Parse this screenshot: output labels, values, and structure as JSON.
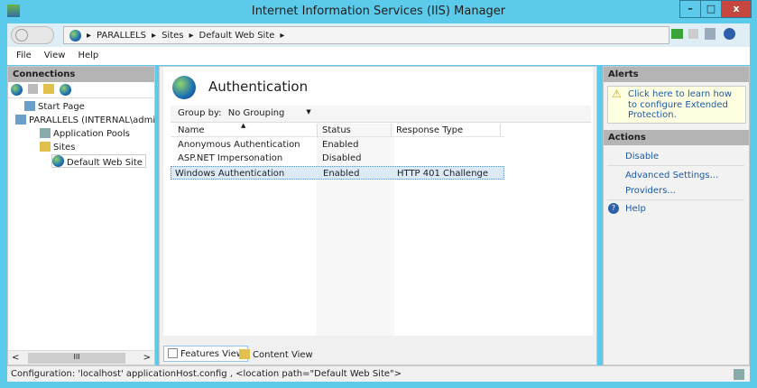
{
  "window": {
    "title": "Internet Information Services (IIS) Manager",
    "min": "–",
    "max": "□",
    "close": "x"
  },
  "address": {
    "crumbs": [
      "PARALLELS",
      "Sites",
      "Default Web Site"
    ],
    "sep": "▸"
  },
  "menu": [
    {
      "label": "File"
    },
    {
      "label": "View"
    },
    {
      "label": "Help"
    }
  ],
  "connections": {
    "title": "Connections",
    "tree": [
      {
        "label": "Start Page"
      },
      {
        "label": "PARALLELS (INTERNAL\\admi"
      },
      {
        "label": "Application Pools"
      },
      {
        "label": "Sites"
      },
      {
        "label": "Default Web Site"
      }
    ],
    "scroll_thumb": "III"
  },
  "main": {
    "title": "Authentication",
    "group_by_label": "Group by:",
    "group_by_value": "No Grouping",
    "columns": [
      "Name",
      "Status",
      "Response Type"
    ],
    "rows": [
      {
        "name": "Anonymous Authentication",
        "status": "Enabled",
        "type": ""
      },
      {
        "name": "ASP.NET Impersonation",
        "status": "Disabled",
        "type": ""
      },
      {
        "name": "Windows Authentication",
        "status": "Enabled",
        "type": "HTTP 401 Challenge"
      }
    ],
    "features_view": "Features View",
    "content_view": "Content View"
  },
  "alerts": {
    "title": "Alerts",
    "message": "Click here to learn how to configure Extended Protection."
  },
  "actions": {
    "title": "Actions",
    "items": [
      "Disable",
      "Advanced Settings...",
      "Providers...",
      "Help"
    ]
  },
  "status": "Configuration: 'localhost' applicationHost.config , <location path=\"Default Web Site\">"
}
